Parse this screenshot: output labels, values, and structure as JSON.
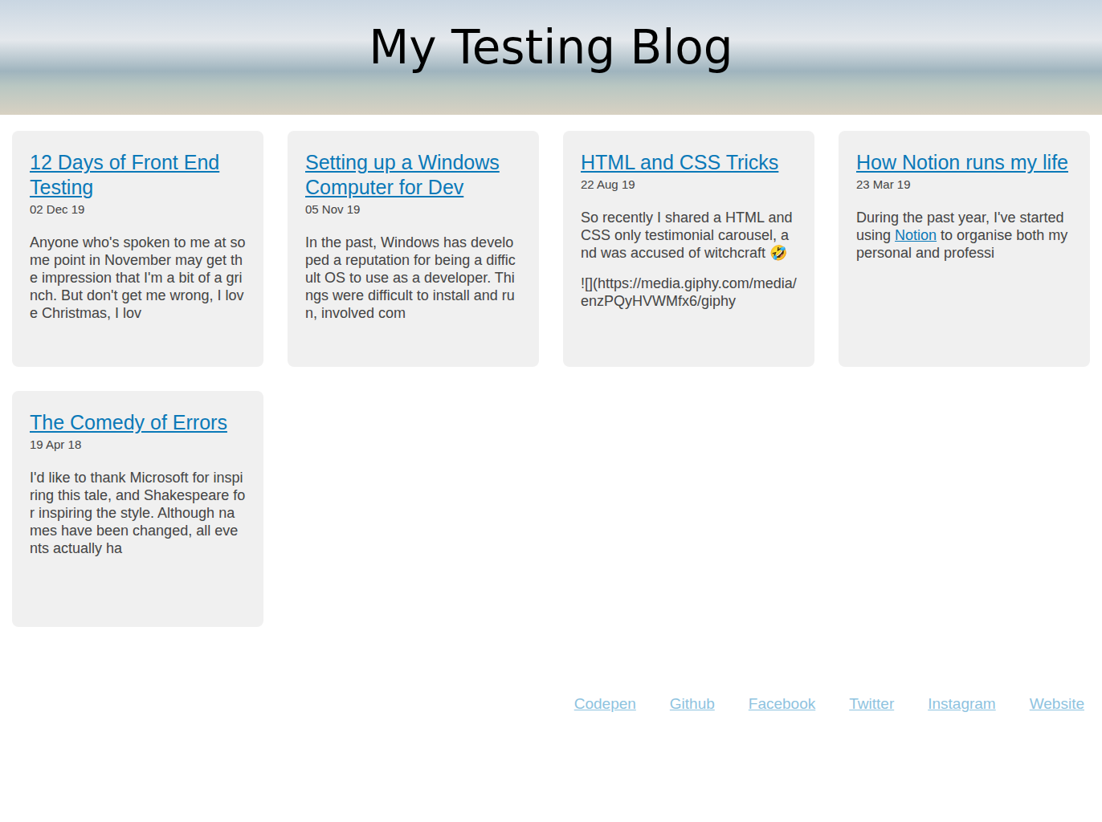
{
  "header": {
    "title": "My Testing Blog"
  },
  "posts": [
    {
      "title": "12 Days of Front End Testing",
      "date": "02 Dec 19",
      "paragraphs": [
        [
          {
            "kind": "text",
            "text": "Anyone who's spoken to me at some point in November may get the impression that I'm a bit of a grinch. But don't get me wrong, I love Christmas, I lov"
          }
        ]
      ]
    },
    {
      "title": "Setting up a Windows Computer for Dev",
      "date": "05 Nov 19",
      "paragraphs": [
        [
          {
            "kind": "text",
            "text": "In the past, Windows has developed a reputation for being a difficult OS to use as a developer. Things were difficult to install and run, involved com"
          }
        ]
      ]
    },
    {
      "title": "HTML and CSS Tricks",
      "date": "22 Aug 19",
      "paragraphs": [
        [
          {
            "kind": "text",
            "text": "So recently I shared a HTML and CSS only testimonial carousel, and was accused of witchcraft 🤣"
          }
        ],
        [
          {
            "kind": "text",
            "text": "![](https://media.giphy.com/media/enzPQyHVWMfx6/giphy"
          }
        ]
      ]
    },
    {
      "title": "How Notion runs my life",
      "date": "23 Mar 19",
      "paragraphs": [
        [
          {
            "kind": "text",
            "text": "During the past year, I've started using "
          },
          {
            "kind": "link",
            "text": "Notion"
          },
          {
            "kind": "text",
            "text": " to organise both my personal and professi"
          }
        ]
      ]
    },
    {
      "title": "The Comedy of Errors",
      "date": "19 Apr 18",
      "paragraphs": [
        [
          {
            "kind": "text",
            "text": "I'd like to thank Microsoft for inspiring this tale, and Shakespeare for inspiring the style. Although names have been changed, all events actually ha"
          }
        ]
      ]
    }
  ],
  "footer": {
    "links": [
      "Codepen",
      "Github",
      "Facebook",
      "Twitter",
      "Instagram",
      "Website"
    ]
  }
}
